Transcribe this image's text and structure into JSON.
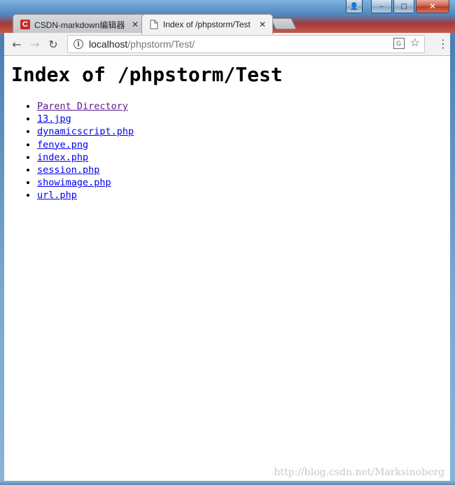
{
  "window": {
    "caption_buttons": {
      "user": "👤",
      "minimize": "–",
      "maximize": "□",
      "close": "✕"
    }
  },
  "tabs": [
    {
      "title": "CSDN-markdown编辑器",
      "favicon": "csdn-logo",
      "favicon_text": "C",
      "active": false,
      "close": "✕"
    },
    {
      "title": "Index of /phpstorm/Test",
      "favicon": "document-icon",
      "active": true,
      "close": "✕"
    }
  ],
  "toolbar": {
    "back": "←",
    "forward": "→",
    "reload": "↻",
    "info_glyph": "i",
    "url_host": "localhost",
    "url_path": "/phpstorm/Test/",
    "translate_glyph": "G",
    "star": "☆",
    "menu": "⋮"
  },
  "page": {
    "heading": "Index of /phpstorm/Test",
    "items": [
      {
        "label": "Parent Directory",
        "visited": true
      },
      {
        "label": "13.jpg"
      },
      {
        "label": "dynamicscript.php"
      },
      {
        "label": "fenye.png"
      },
      {
        "label": "index.php"
      },
      {
        "label": "session.php"
      },
      {
        "label": "showimage.php"
      },
      {
        "label": "url.php"
      }
    ],
    "watermark": "http://blog.csdn.net/Marksinoberg"
  },
  "colors": {
    "link": "#0000ee",
    "visited_link": "#551a8b",
    "csdn_red": "#c52b2b"
  }
}
